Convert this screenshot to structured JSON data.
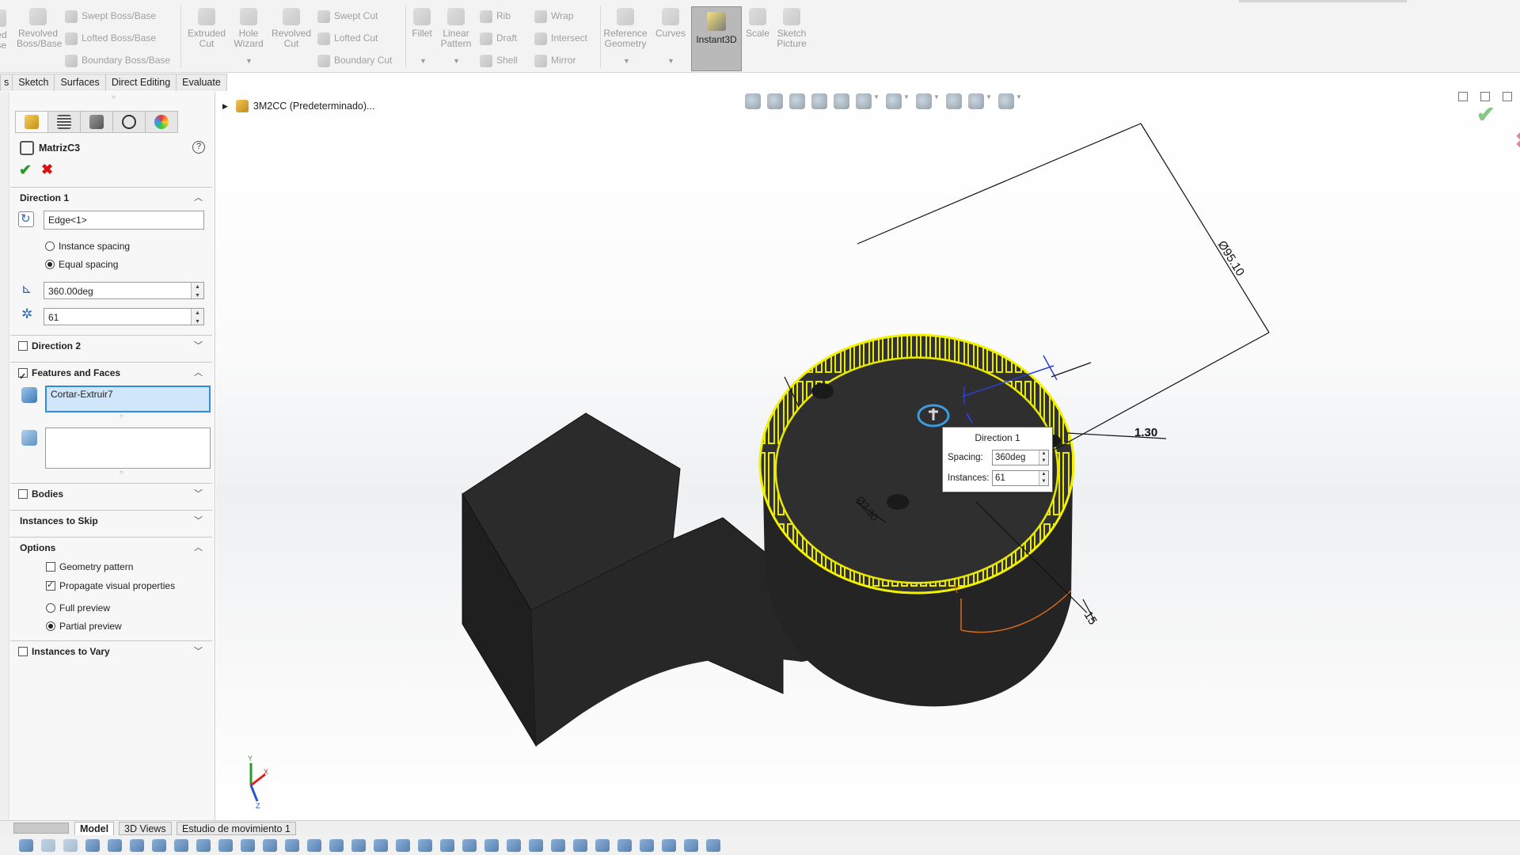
{
  "ribbon": {
    "revolved_boss": "Revolved Boss/Base",
    "revolved_boss_left": "ed\nse",
    "swept_boss": "Swept Boss/Base",
    "lofted_boss": "Lofted Boss/Base",
    "boundary_boss": "Boundary Boss/Base",
    "extruded_cut": "Extruded Cut",
    "hole_wizard": "Hole Wizard",
    "revolved_cut": "Revolved Cut",
    "swept_cut": "Swept Cut",
    "lofted_cut": "Lofted Cut",
    "boundary_cut": "Boundary Cut",
    "fillet": "Fillet",
    "linear_pattern": "Linear Pattern",
    "rib": "Rib",
    "draft": "Draft",
    "shell": "Shell",
    "wrap": "Wrap",
    "intersect": "Intersect",
    "mirror": "Mirror",
    "reference_geometry": "Reference Geometry",
    "curves": "Curves",
    "instant3d": "Instant3D",
    "scale": "Scale",
    "sketch_picture": "Sketch Picture"
  },
  "command_tabs": [
    "s",
    "Sketch",
    "Surfaces",
    "Direct Editing",
    "Evaluate"
  ],
  "property_manager": {
    "title": "MatrizC3",
    "help": "?",
    "direction1": {
      "header": "Direction 1",
      "edge_value": "Edge<1>",
      "instance_spacing_label": "Instance spacing",
      "equal_spacing_label": "Equal spacing",
      "angle_value": "360.00deg",
      "instances_value": "61"
    },
    "direction2": {
      "header": "Direction 2"
    },
    "features_faces": {
      "header": "Features and Faces",
      "feature_value": "Cortar-Extruir7"
    },
    "bodies": {
      "header": "Bodies"
    },
    "instances_to_skip": {
      "header": "Instances to Skip"
    },
    "options": {
      "header": "Options",
      "geometry_pattern": "Geometry pattern",
      "propagate_visual": "Propagate visual properties",
      "full_preview": "Full preview",
      "partial_preview": "Partial preview"
    },
    "instances_to_vary": {
      "header": "Instances to Vary"
    }
  },
  "graphics": {
    "tree_root": "3M2CC (Predeterminado)...",
    "dim_diameter_outer": "Ø95.10",
    "dim_thickness": "1.30",
    "dim_height": "15",
    "dim_hole": "Ø3.30",
    "popup": {
      "header": "Direction 1",
      "spacing_label": "Spacing:",
      "spacing_value": "360deg",
      "instances_label": "Instances:",
      "instances_value": "61"
    },
    "triad_x": "X",
    "triad_y": "Y",
    "triad_z": "Z"
  },
  "bottom_tabs": [
    "Model",
    "3D Views",
    "Estudio de movimiento 1"
  ],
  "colors": {
    "highlight_yellow": "#f2f200",
    "part_dark": "#333333",
    "selection_blue": "#2f8ce0",
    "ok_green": "#2a9b2a",
    "cancel_red": "#dd1111"
  }
}
